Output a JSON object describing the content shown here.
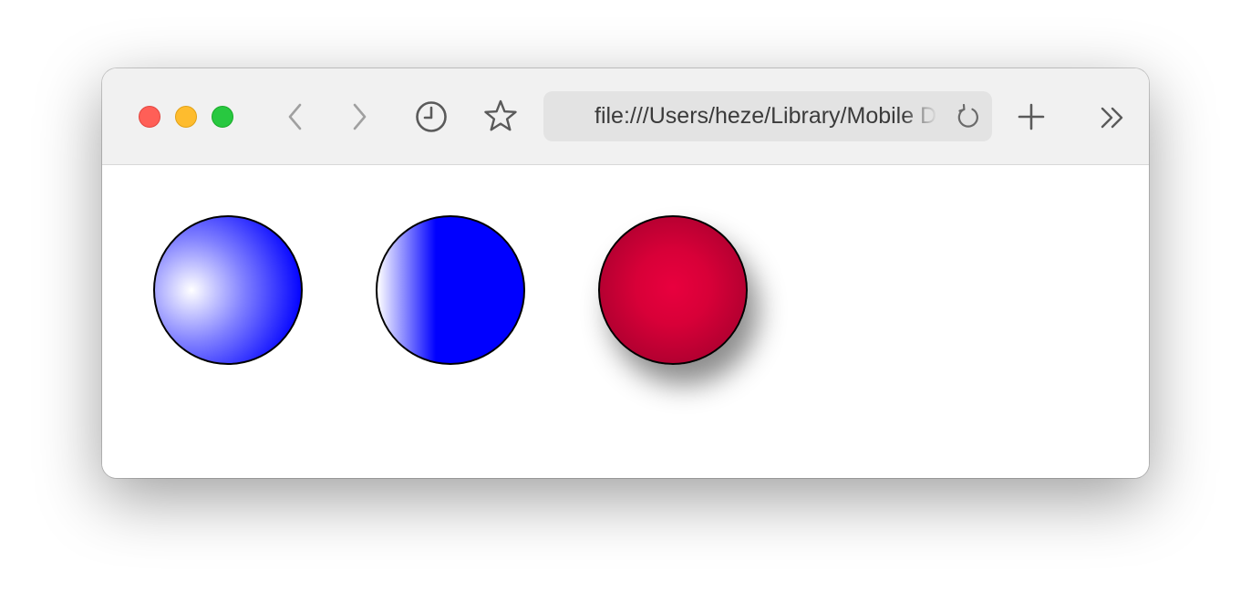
{
  "toolbar": {
    "icons": {
      "back": "chevron-left-icon",
      "forward": "chevron-right-icon",
      "history": "clock-icon",
      "bookmark": "star-icon",
      "reload": "reload-icon",
      "new_tab": "plus-icon",
      "more": "double-chevron-right-icon"
    },
    "url": "file:///Users/heze/Library/Mobile Documents"
  },
  "traffic_lights": {
    "close_color": "#ff5f57",
    "minimize_color": "#febc2e",
    "maximize_color": "#28c840"
  },
  "content": {
    "balls": [
      {
        "style": "radial-gradient",
        "colors": [
          "#ffffff",
          "#0000ff"
        ]
      },
      {
        "style": "linear-gradient",
        "colors": [
          "#ffffff",
          "#0000ff"
        ]
      },
      {
        "style": "radial-gradient-with-shadow",
        "colors": [
          "#e8003e",
          "#90001f"
        ]
      }
    ]
  }
}
